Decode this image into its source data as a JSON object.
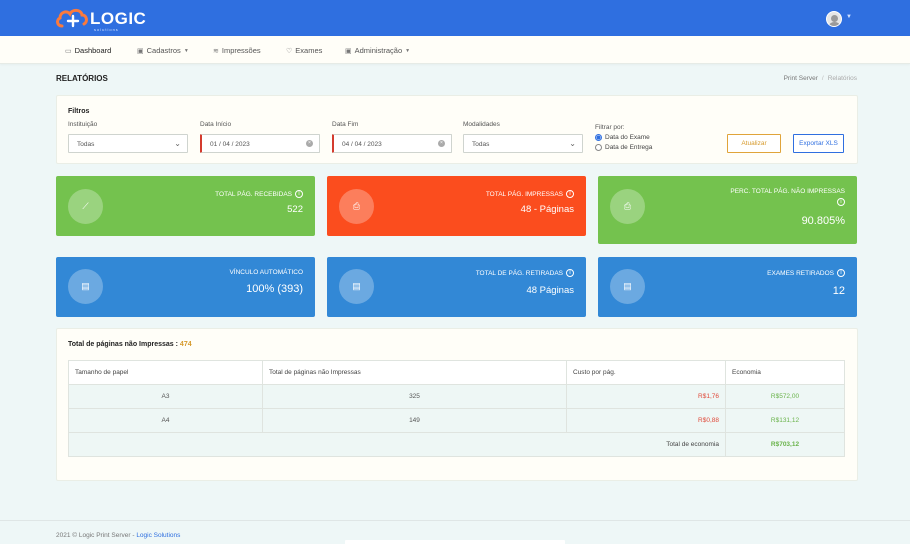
{
  "app": {
    "logo_text": "LOGIC",
    "logo_sub": "solutions"
  },
  "nav": {
    "items": [
      {
        "label": "Dashboard",
        "icon": "monitor-icon",
        "active": true
      },
      {
        "label": "Cadastros",
        "icon": "briefcase-icon",
        "dropdown": true
      },
      {
        "label": "Impressões",
        "icon": "layers-icon"
      },
      {
        "label": "Exames",
        "icon": "heart-icon"
      },
      {
        "label": "Administração",
        "icon": "briefcase-icon",
        "dropdown": true
      }
    ]
  },
  "page": {
    "title": "RELATÓRIOS",
    "breadcrumb": [
      "Print Server",
      "Relatórios"
    ]
  },
  "filters": {
    "title": "Filtros",
    "instituicao": {
      "label": "Instituição",
      "value": "Todas"
    },
    "data_inicio": {
      "label": "Data Início",
      "value": "01 / 04 / 2023"
    },
    "data_fim": {
      "label": "Data Fim",
      "value": "04 / 04 / 2023"
    },
    "modalidades": {
      "label": "Modalidades",
      "value": "Todas"
    },
    "filtrar_por": {
      "label": "Filtrar por:",
      "options": [
        "Data do Exame",
        "Data de Entrega"
      ],
      "selected": "Data do Exame"
    },
    "update_label": "Atualizar",
    "export_label": "Exportar XLS"
  },
  "stats": [
    {
      "label": "TOTAL PÁG. RECEBIDAS",
      "value": "522",
      "color": "#74c24e",
      "icon": "chart-line-icon"
    },
    {
      "label": "TOTAL PÁG. IMPRESSAS",
      "value": "48 - Páginas",
      "color": "#fb4d1e",
      "icon": "printer-icon"
    },
    {
      "label": "PERC. TOTAL PÁG. NÃO IMPRESSAS",
      "value": "90.805%",
      "color": "#74c24e",
      "icon": "printer-off-icon"
    },
    {
      "label": "VÍNCULO AUTOMÁTICO",
      "value": "100% (393)",
      "color": "#3288d6",
      "icon": "file-icon"
    },
    {
      "label": "TOTAL DE PÁG. RETIRADAS",
      "value": "48 Páginas",
      "color": "#3288d6",
      "icon": "file-icon"
    },
    {
      "label": "EXAMES RETIRADOS",
      "value": "12",
      "color": "#3288d6",
      "icon": "file-icon"
    }
  ],
  "table": {
    "title": "Total de páginas não Impressas :",
    "count": "474",
    "headers": [
      "Tamanho de papel",
      "Total de páginas não Impressas",
      "Custo por pág.",
      "Economia"
    ],
    "rows": [
      [
        "A3",
        "325",
        "R$1,76",
        "R$572,00"
      ],
      [
        "A4",
        "149",
        "R$0,88",
        "R$131,12"
      ]
    ],
    "total_label": "Total de economia",
    "total_value": "R$703,12"
  },
  "footer": {
    "text": "2021 © Logic Print Server - ",
    "link": "Logic Solutions"
  }
}
